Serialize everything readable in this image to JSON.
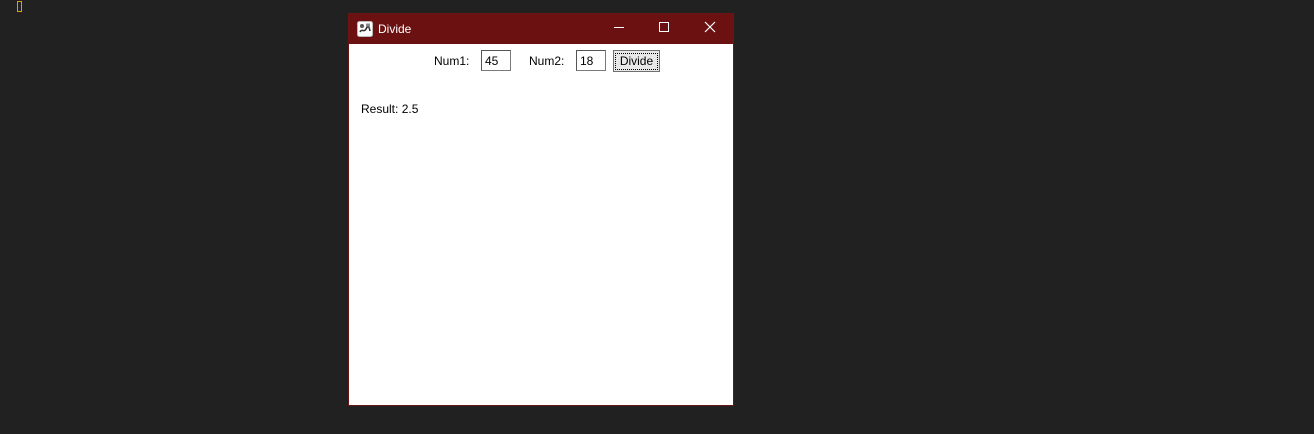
{
  "window": {
    "title": "Divide",
    "icon": "java-app-icon"
  },
  "titlebar_controls": {
    "minimize_icon": "minimize-icon",
    "maximize_icon": "maximize-icon",
    "close_icon": "close-icon"
  },
  "form": {
    "num1_label": "Num1:",
    "num1_value": "45",
    "num2_label": "Num2:",
    "num2_value": "18",
    "divide_label": "Divide"
  },
  "result": {
    "label": "Result:",
    "value": "2.5"
  },
  "colors": {
    "titlebar": "#6b1111",
    "desktop": "#212121",
    "caret": "#e0a000"
  }
}
